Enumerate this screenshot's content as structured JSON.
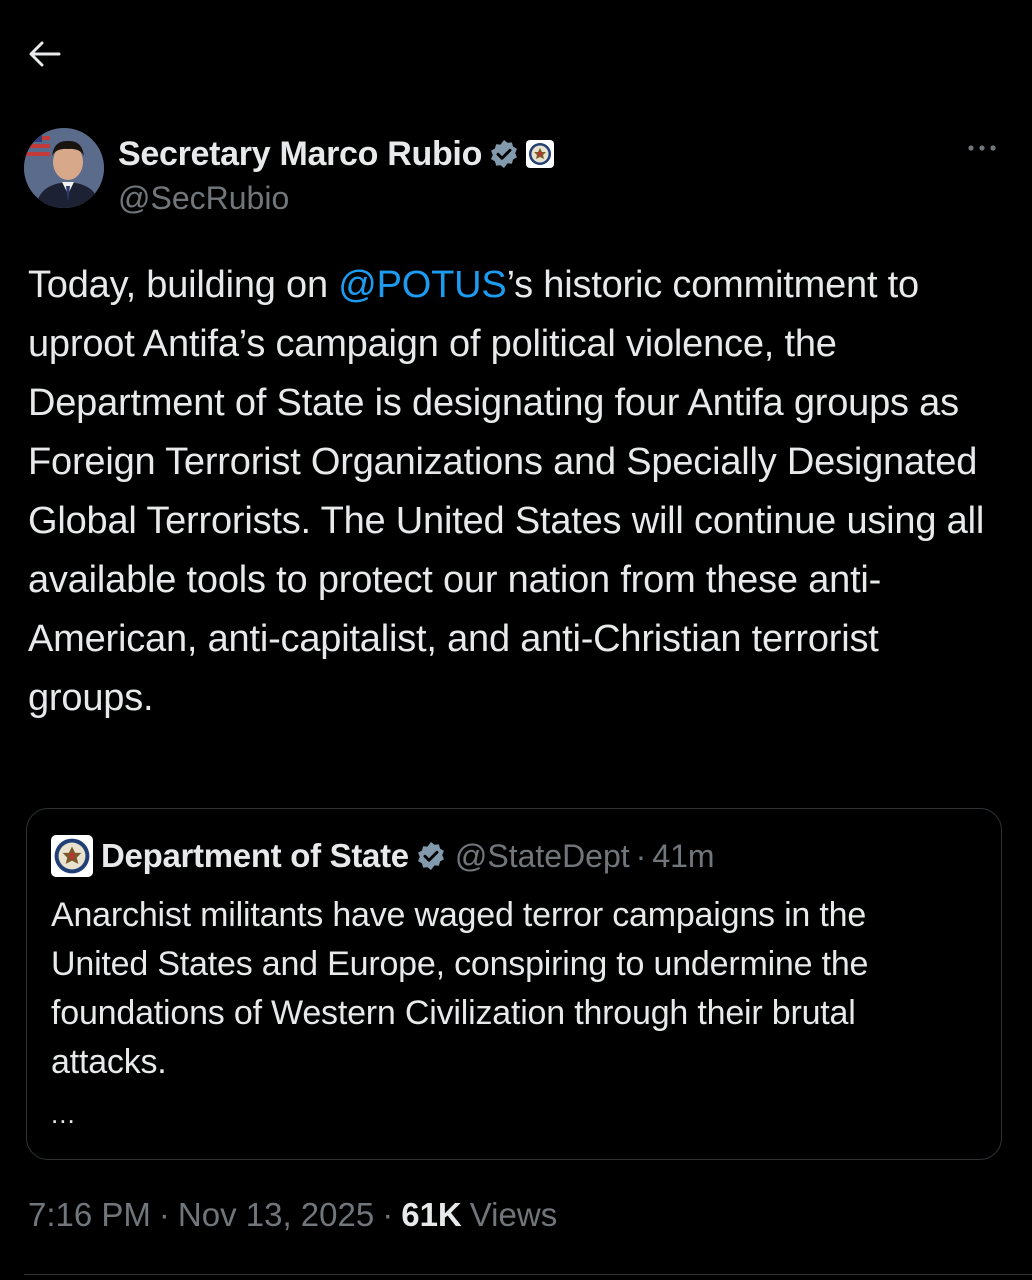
{
  "nav": {
    "back_icon": "arrow-left-icon"
  },
  "author": {
    "display_name": "Secretary Marco Rubio",
    "handle": "@SecRubio",
    "verified_icon": "verified-badge-icon",
    "affiliation_icon": "state-department-seal-icon",
    "more_icon": "more-horizontal-icon"
  },
  "tweet": {
    "text_before": "Today, building on ",
    "mention": "@POTUS",
    "text_after": "’s historic commitment to uproot Antifa’s campaign of political violence, the Department of State is designating four Antifa groups as Foreign Terrorist Organizations and Specially Designated Global Terrorists. The United States will continue using all available tools to protect our nation from these anti-American, anti-capitalist, and anti-Christian terrorist groups."
  },
  "quote": {
    "display_name": "Department of State",
    "handle": "@StateDept",
    "separator": "·",
    "time": "41m",
    "text": "Anarchist militants have waged terror campaigns in the United States and Europe, conspiring to undermine the foundations of Western Civilization through their brutal attacks.",
    "ellipsis": "..."
  },
  "meta": {
    "time": "7:16 PM",
    "separator": "·",
    "date": "Nov 13, 2025",
    "views_count": "61K",
    "views_label": "Views"
  },
  "colors": {
    "background": "#000000",
    "text": "#e7e9ea",
    "muted": "#71767b",
    "accent": "#1d9bf0",
    "border": "#2f3336"
  }
}
